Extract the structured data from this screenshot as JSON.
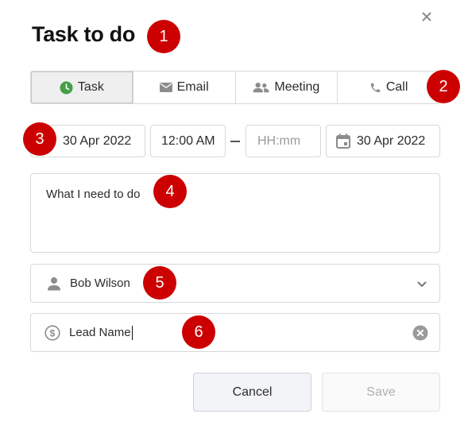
{
  "dialog": {
    "title": "Task to do",
    "close_label": "×"
  },
  "markers": [
    "1",
    "2",
    "3",
    "4",
    "5",
    "6"
  ],
  "tabs": [
    {
      "label": "Task",
      "icon": "clock-icon",
      "active": true
    },
    {
      "label": "Email",
      "icon": "envelope-icon",
      "active": false
    },
    {
      "label": "Meeting",
      "icon": "people-icon",
      "active": false
    },
    {
      "label": "Call",
      "icon": "phone-icon",
      "active": false
    }
  ],
  "schedule": {
    "start_date": "30 Apr 2022",
    "start_time": "12:00 AM",
    "end_time_placeholder": "HH:mm",
    "end_date": "30 Apr 2022"
  },
  "description": {
    "value": "What I need to do"
  },
  "assignee": {
    "value": "Bob Wilson"
  },
  "lead": {
    "value": "Lead Name"
  },
  "actions": {
    "cancel_label": "Cancel",
    "save_label": "Save"
  },
  "colors": {
    "marker": "#cc0000",
    "task_icon": "#43a047",
    "icon_gray": "#8c8c8c"
  }
}
